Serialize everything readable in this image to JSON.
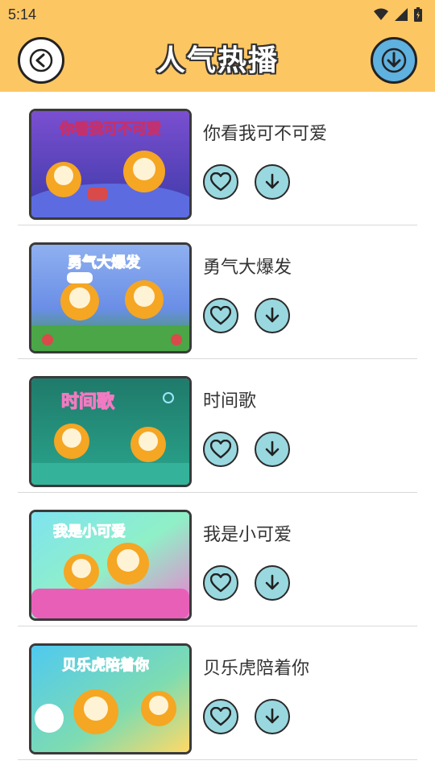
{
  "status_bar": {
    "time": "5:14",
    "icons": [
      "wifi-icon",
      "signal-icon",
      "battery-icon"
    ]
  },
  "header": {
    "title": "人气热播",
    "back_icon": "chevron-left-icon",
    "download_icon": "download-icon",
    "background_color": "#fcc663"
  },
  "songs": [
    {
      "title": "你看我可不可爱",
      "thumbnail_caption": "你看我可不可爱",
      "favorite_icon": "heart-icon",
      "download_icon": "download-icon"
    },
    {
      "title": "勇气大爆发",
      "thumbnail_caption": "勇气大爆发",
      "favorite_icon": "heart-icon",
      "download_icon": "download-icon"
    },
    {
      "title": "时间歌",
      "thumbnail_caption": "时间歌",
      "favorite_icon": "heart-icon",
      "download_icon": "download-icon"
    },
    {
      "title": "我是小可爱",
      "thumbnail_caption": "我是小可爱",
      "favorite_icon": "heart-icon",
      "download_icon": "download-icon"
    },
    {
      "title": "贝乐虎陪着你",
      "thumbnail_caption": "贝乐虎陪着你",
      "favorite_icon": "heart-icon",
      "download_icon": "download-icon"
    }
  ],
  "colors": {
    "header": "#fcc663",
    "action_button": "#9ad8e0",
    "download_all_button": "#5fb1df"
  }
}
